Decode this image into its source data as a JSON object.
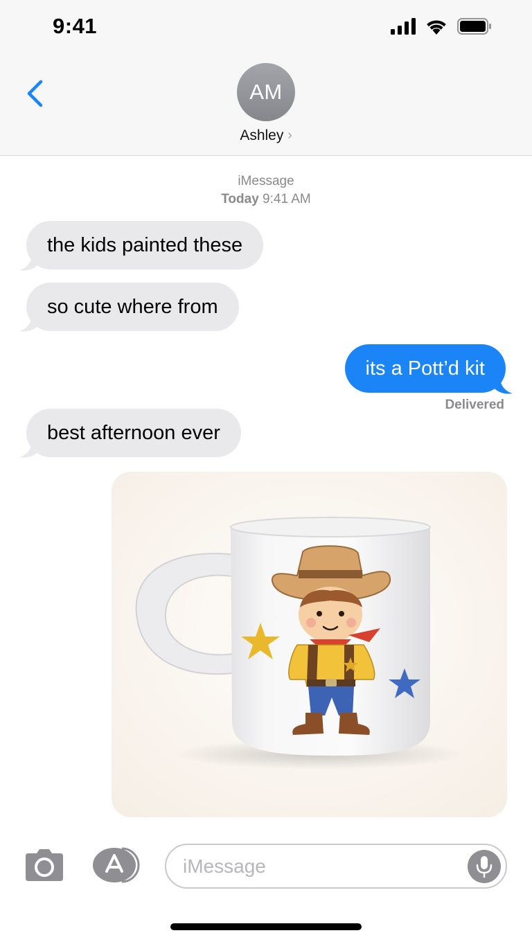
{
  "status_bar": {
    "time": "9:41",
    "icons": [
      "signal-icon",
      "wifi-icon",
      "battery-icon"
    ]
  },
  "header": {
    "back_icon": "chevron-left-icon",
    "avatar_initials": "AM",
    "contact_name": "Ashley",
    "contact_chevron": "›"
  },
  "thread": {
    "service": "iMessage",
    "date_day": "Today",
    "date_time": "9:41 AM",
    "messages": [
      {
        "direction": "incoming",
        "text": "the kids painted these"
      },
      {
        "direction": "incoming",
        "text": "so cute where from"
      },
      {
        "direction": "outgoing",
        "text": "its a Pott’d kit",
        "status": "Delivered"
      },
      {
        "direction": "incoming",
        "text": "best afternoon ever"
      },
      {
        "direction": "incoming",
        "type": "photo",
        "description_icon": "photo-mug-cowboy"
      }
    ]
  },
  "input_bar": {
    "camera_icon": "camera-icon",
    "apps_icon": "app-store-icon",
    "placeholder": "iMessage",
    "value": "",
    "mic_icon": "microphone-icon"
  },
  "colors": {
    "outgoing_bubble": "#1b84f7",
    "incoming_bubble": "#e9e9eb",
    "accent": "#1b84f7",
    "meta_text": "#8a8a8e"
  }
}
